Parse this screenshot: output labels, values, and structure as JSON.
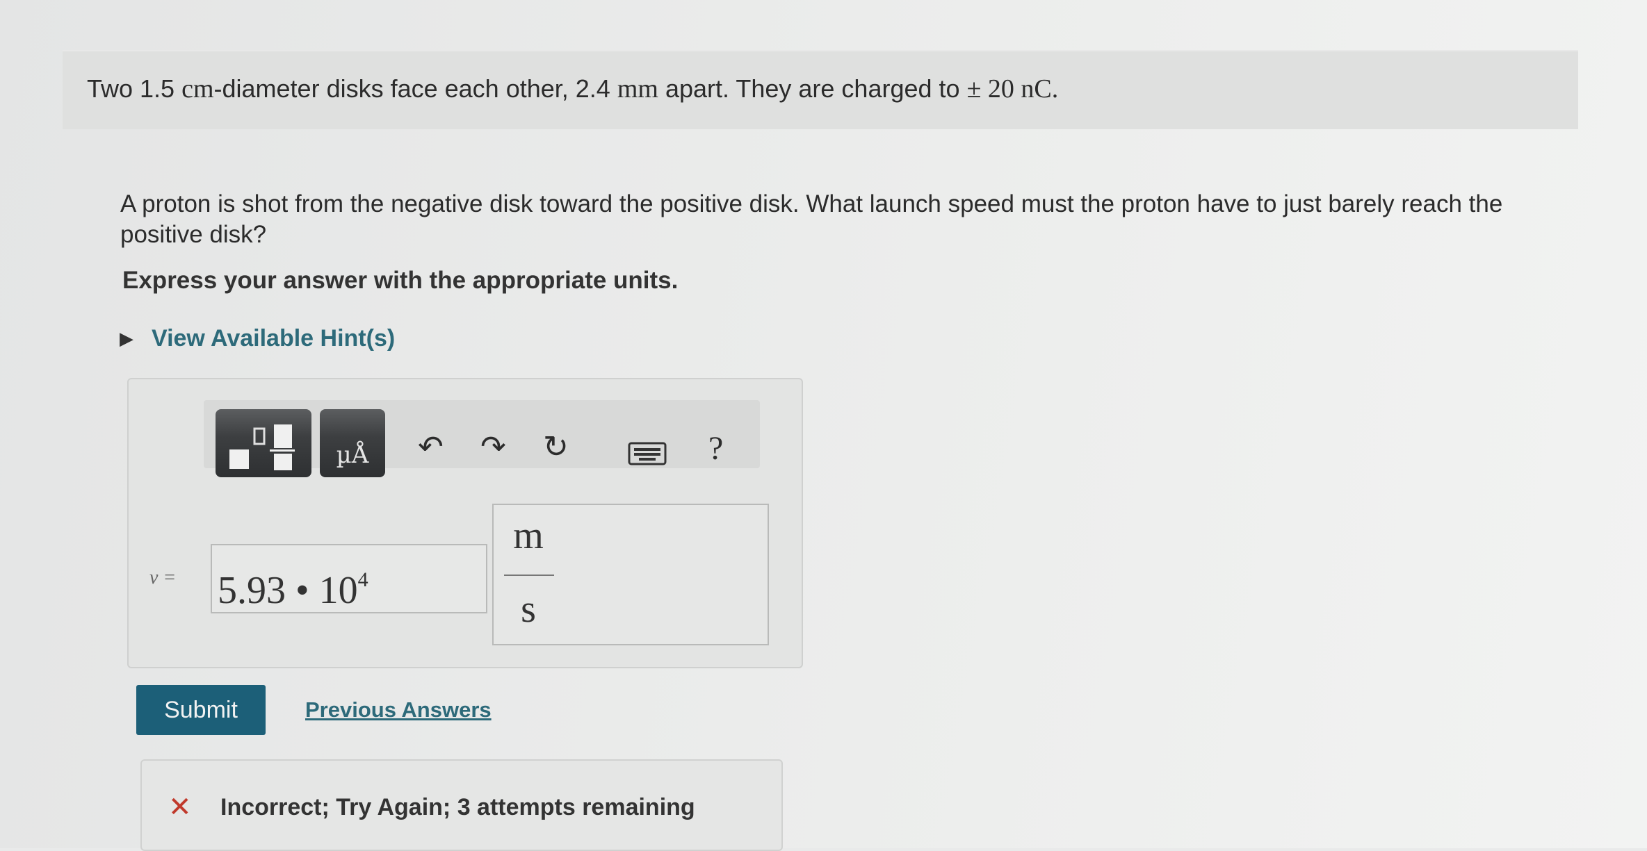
{
  "problem": {
    "intro": {
      "part1": "Two 1.5 ",
      "cm": "cm",
      "part2": "-diameter disks face each other, 2.4 ",
      "mm": "mm",
      "part3": " apart. They are charged to ",
      "charge": "± 20 nC."
    },
    "question": "A proton is shot from the negative disk toward the positive disk. What launch speed must the proton have to just barely reach the positive disk?",
    "instruction": "Express your answer with the appropriate units.",
    "hint_label": "View Available Hint(s)"
  },
  "toolbar": {
    "units_glyph": "µÅ",
    "undo_icon": "undo-arrow",
    "redo_icon": "redo-arrow",
    "reset_icon": "reset",
    "keyboard_icon": "keyboard",
    "help": "?"
  },
  "answer": {
    "variable": "v =",
    "mantissa": "5.93 • 10",
    "exponent": "4",
    "unit_numerator": "m",
    "unit_denominator": "s"
  },
  "actions": {
    "submit": "Submit",
    "previous_answers": "Previous Answers"
  },
  "feedback": {
    "icon": "✕",
    "message": "Incorrect; Try Again; 3 attempts remaining",
    "status_color": "#c0392b"
  },
  "colors": {
    "accent": "#1c5f78",
    "link": "#2d6a7a"
  }
}
